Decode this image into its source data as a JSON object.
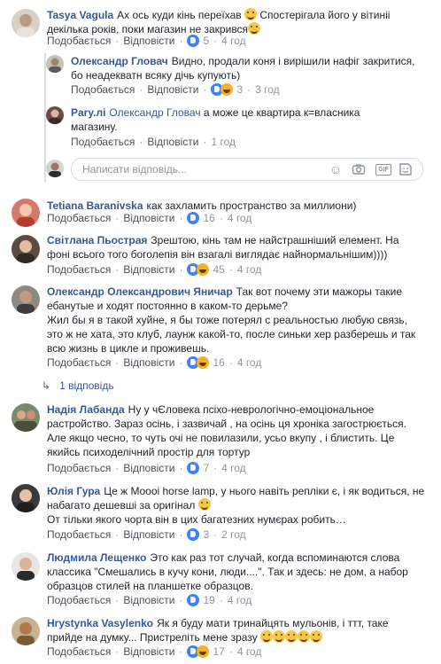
{
  "labels": {
    "like": "Подобається",
    "reply": "Відповісти",
    "reply_placeholder": "Написати відповідь...",
    "sep": "·"
  },
  "comments": [
    {
      "author": "Tasya Vagula",
      "text": "Ах ось куди кінь переїхав",
      "text2": "Спостерігала його у вітиніі декілька років, поки магазин не закрився",
      "reactions": "5",
      "time": "4 год",
      "emoji": "grinning-face"
    },
    {
      "author": "Олександр Гловач",
      "text": "Видно, продали коня і вирішили нафіг закритися, бо неадекватн всяку дічь купують)",
      "reactions": "3",
      "time": "3 год"
    },
    {
      "author": "Pary.лі",
      "mention": "Олександр Гловач",
      "text": "а може це квартира к=власника магазину.",
      "time": "1 год"
    },
    {
      "author": "Tetiana Baranivska",
      "text": "как захламить пространство за миллиони)",
      "reactions": "16",
      "time": "4 год"
    },
    {
      "author": "Світлана Пьострая",
      "text": "Зрештою, кінь там не найстрашніший елемент. На фоні всього того боголепія він взагалі виглядає найнормальнішим))))",
      "reactions": "45",
      "time": "4 год"
    },
    {
      "author": "Олександр Олександрович Яничар",
      "text": "Так вот почему эти мажоры такие ебанутые и ходят постоянно в каком-то дерьме?",
      "text2": "Жил бы я в такой хуйне, я бы тоже потерял с реальностью любую связь, это ж не хата, это клуб, лаунж какой-то, после синьки хер разберешь и так всю жизнь в цикле и проживешь.",
      "reactions": "16",
      "time": "4 год"
    },
    {
      "author": "Надія Лабанда",
      "text": "Ну у чЄловека псіхо-неврологічно-емоціональное растройство. Зараз осінь, і зазвичай , на осінь ця хроніка загострюється. Але якщо чесно, то чуть очі не повилазили, усьо вкупу , і блистить. Це якийсь психоделічний простір для тортур",
      "reactions": "7",
      "time": "4 год"
    },
    {
      "author": "Юлія Гура",
      "text": "Це ж Moooi horse lamp, у нього навіть репліки є, і як водиться, не набагато дешевші за оригінал",
      "text2": "От тільки якого чорта він в цих багатезних нумєрах робить…",
      "reactions": "3",
      "time": "2 год"
    },
    {
      "author": "Людмила Лещенко",
      "text": "Это как раз тот случай, когда вспоминаются слова классика \"Смешались в кучу кони, люди....\". Так и здесь: не дом, а набор образцов стилей на планшетке образцов.",
      "reactions": "19",
      "time": "4 год"
    },
    {
      "author": "Hrystynka Vasylenko",
      "text": "Як я буду мати тринайцять мульонів, і ттт, таке прийде на думку... Пристреліть мене зразу",
      "reactions": "17",
      "time": "4 год"
    }
  ],
  "replies_link": "1 відповідь",
  "colors": {
    "link": "#365899",
    "meta": "#90949c",
    "like": "#4080ff",
    "haha": "#f7b125"
  },
  "reply_box_icons": [
    "smiley-icon",
    "camera-icon",
    "gif-icon",
    "sticker-icon"
  ]
}
